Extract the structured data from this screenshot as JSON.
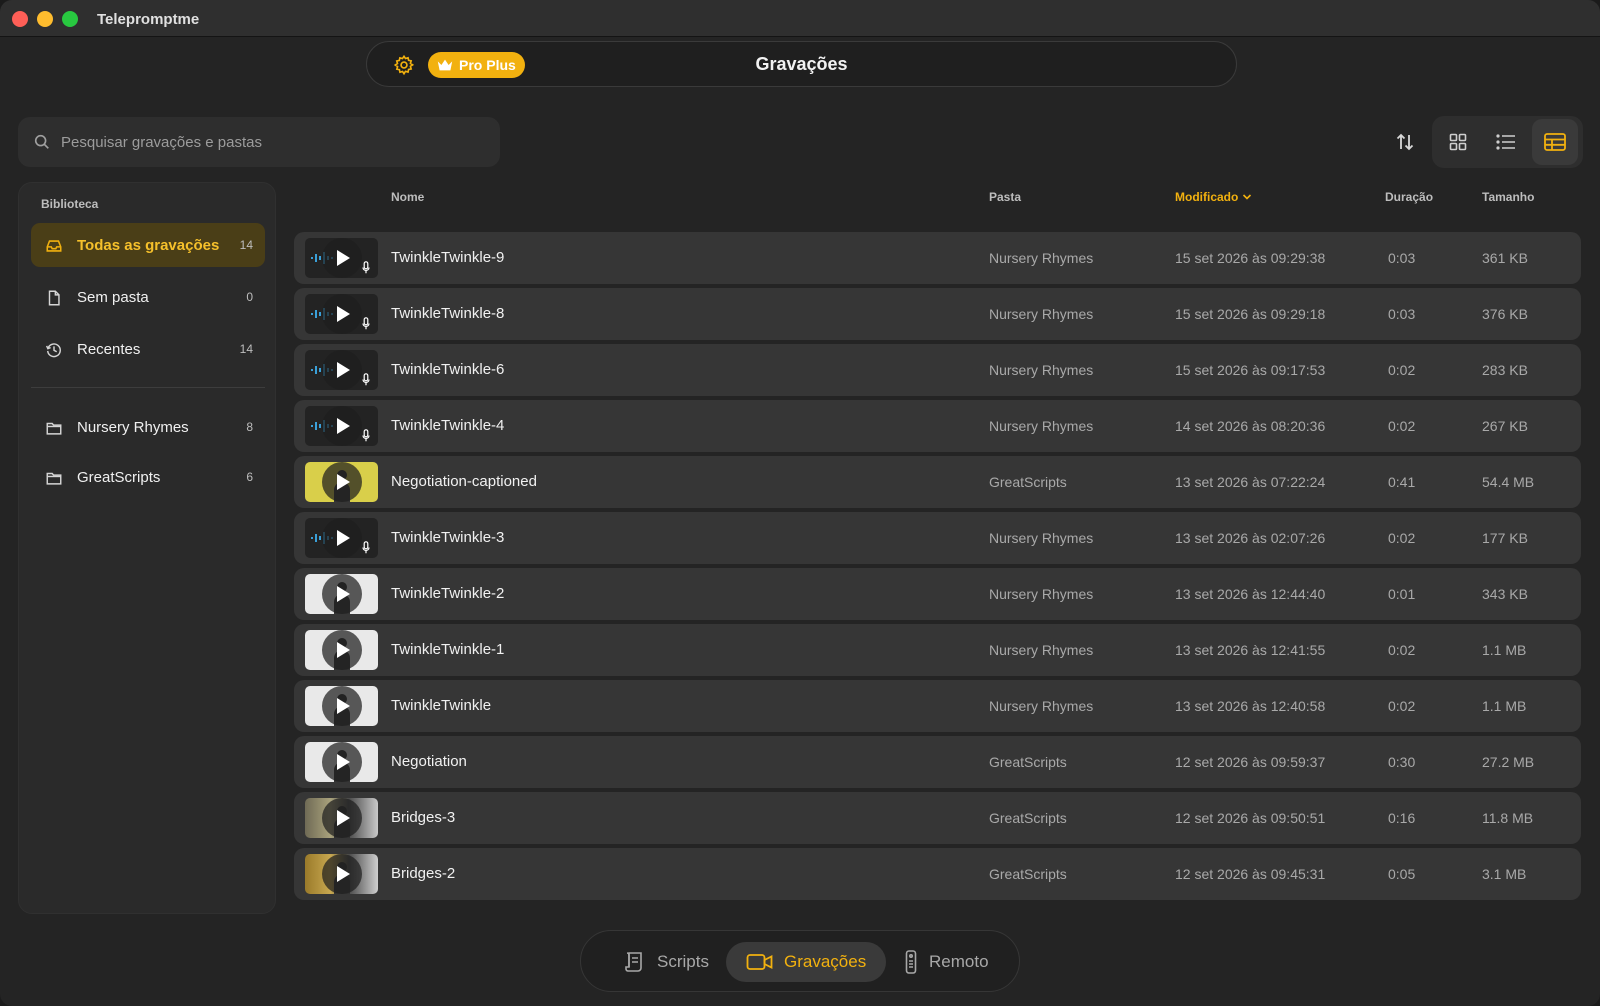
{
  "window": {
    "title": "Telepromptme"
  },
  "header": {
    "title": "Gravações",
    "badge": "Pro Plus"
  },
  "search": {
    "placeholder": "Pesquisar gravações e pastas",
    "value": ""
  },
  "colors": {
    "accent": "#f2b10f",
    "active_sidebar_bg": "#4a3e17"
  },
  "toolbar": {
    "icons": [
      "sort-icon",
      "grid-view-icon",
      "list-view-icon",
      "table-view-icon"
    ],
    "active_view": "table"
  },
  "sidebar": {
    "heading": "Biblioteca",
    "items": [
      {
        "label": "Todas as gravações",
        "count": "14",
        "icon": "tray-icon",
        "active": true
      },
      {
        "label": "Sem pasta",
        "count": "0",
        "icon": "document-icon",
        "active": false
      },
      {
        "label": "Recentes",
        "count": "14",
        "icon": "clock-icon",
        "active": false
      }
    ],
    "folders": [
      {
        "label": "Nursery Rhymes",
        "count": "8",
        "icon": "folder-icon"
      },
      {
        "label": "GreatScripts",
        "count": "6",
        "icon": "folder-icon"
      }
    ]
  },
  "table": {
    "columns": {
      "name": "Nome",
      "folder": "Pasta",
      "modified": "Modificado",
      "duration": "Duração",
      "size": "Tamanho"
    },
    "sorted_by": "modified",
    "rows": [
      {
        "name": "TwinkleTwinkle-9",
        "folder": "Nursery Rhymes",
        "modified": "15 set 2026 às 09:29:38",
        "duration": "0:03",
        "size": "361 KB",
        "thumb": "audio"
      },
      {
        "name": "TwinkleTwinkle-8",
        "folder": "Nursery Rhymes",
        "modified": "15 set 2026 às 09:29:18",
        "duration": "0:03",
        "size": "376 KB",
        "thumb": "audio"
      },
      {
        "name": "TwinkleTwinkle-6",
        "folder": "Nursery Rhymes",
        "modified": "15 set 2026 às 09:17:53",
        "duration": "0:02",
        "size": "283 KB",
        "thumb": "audio"
      },
      {
        "name": "TwinkleTwinkle-4",
        "folder": "Nursery Rhymes",
        "modified": "14 set 2026 às 08:20:36",
        "duration": "0:02",
        "size": "267 KB",
        "thumb": "audio"
      },
      {
        "name": "Negotiation-captioned",
        "folder": "GreatScripts",
        "modified": "13 set 2026 às 07:22:24",
        "duration": "0:41",
        "size": "54.4 MB",
        "thumb": "video-yellow"
      },
      {
        "name": "TwinkleTwinkle-3",
        "folder": "Nursery Rhymes",
        "modified": "13 set 2026 às 02:07:26",
        "duration": "0:02",
        "size": "177 KB",
        "thumb": "audio"
      },
      {
        "name": "TwinkleTwinkle-2",
        "folder": "Nursery Rhymes",
        "modified": "13 set 2026 às 12:44:40",
        "duration": "0:01",
        "size": "343 KB",
        "thumb": "video-light"
      },
      {
        "name": "TwinkleTwinkle-1",
        "folder": "Nursery Rhymes",
        "modified": "13 set 2026 às 12:41:55",
        "duration": "0:02",
        "size": "1.1 MB",
        "thumb": "video-light"
      },
      {
        "name": "TwinkleTwinkle",
        "folder": "Nursery Rhymes",
        "modified": "13 set 2026 às 12:40:58",
        "duration": "0:02",
        "size": "1.1 MB",
        "thumb": "video-light"
      },
      {
        "name": "Negotiation",
        "folder": "GreatScripts",
        "modified": "12 set 2026 às 09:59:37",
        "duration": "0:30",
        "size": "27.2 MB",
        "thumb": "video-light"
      },
      {
        "name": "Bridges-3",
        "folder": "GreatScripts",
        "modified": "12 set 2026 às 09:50:51",
        "duration": "0:16",
        "size": "11.8 MB",
        "thumb": "video-bridge"
      },
      {
        "name": "Bridges-2",
        "folder": "GreatScripts",
        "modified": "12 set 2026 às 09:45:31",
        "duration": "0:05",
        "size": "3.1 MB",
        "thumb": "video-bridge2"
      }
    ]
  },
  "tabbar": {
    "tabs": [
      {
        "label": "Scripts",
        "icon": "script-icon",
        "active": false
      },
      {
        "label": "Gravações",
        "icon": "video-camera-icon",
        "active": true
      },
      {
        "label": "Remoto",
        "icon": "remote-icon",
        "active": false
      }
    ]
  }
}
